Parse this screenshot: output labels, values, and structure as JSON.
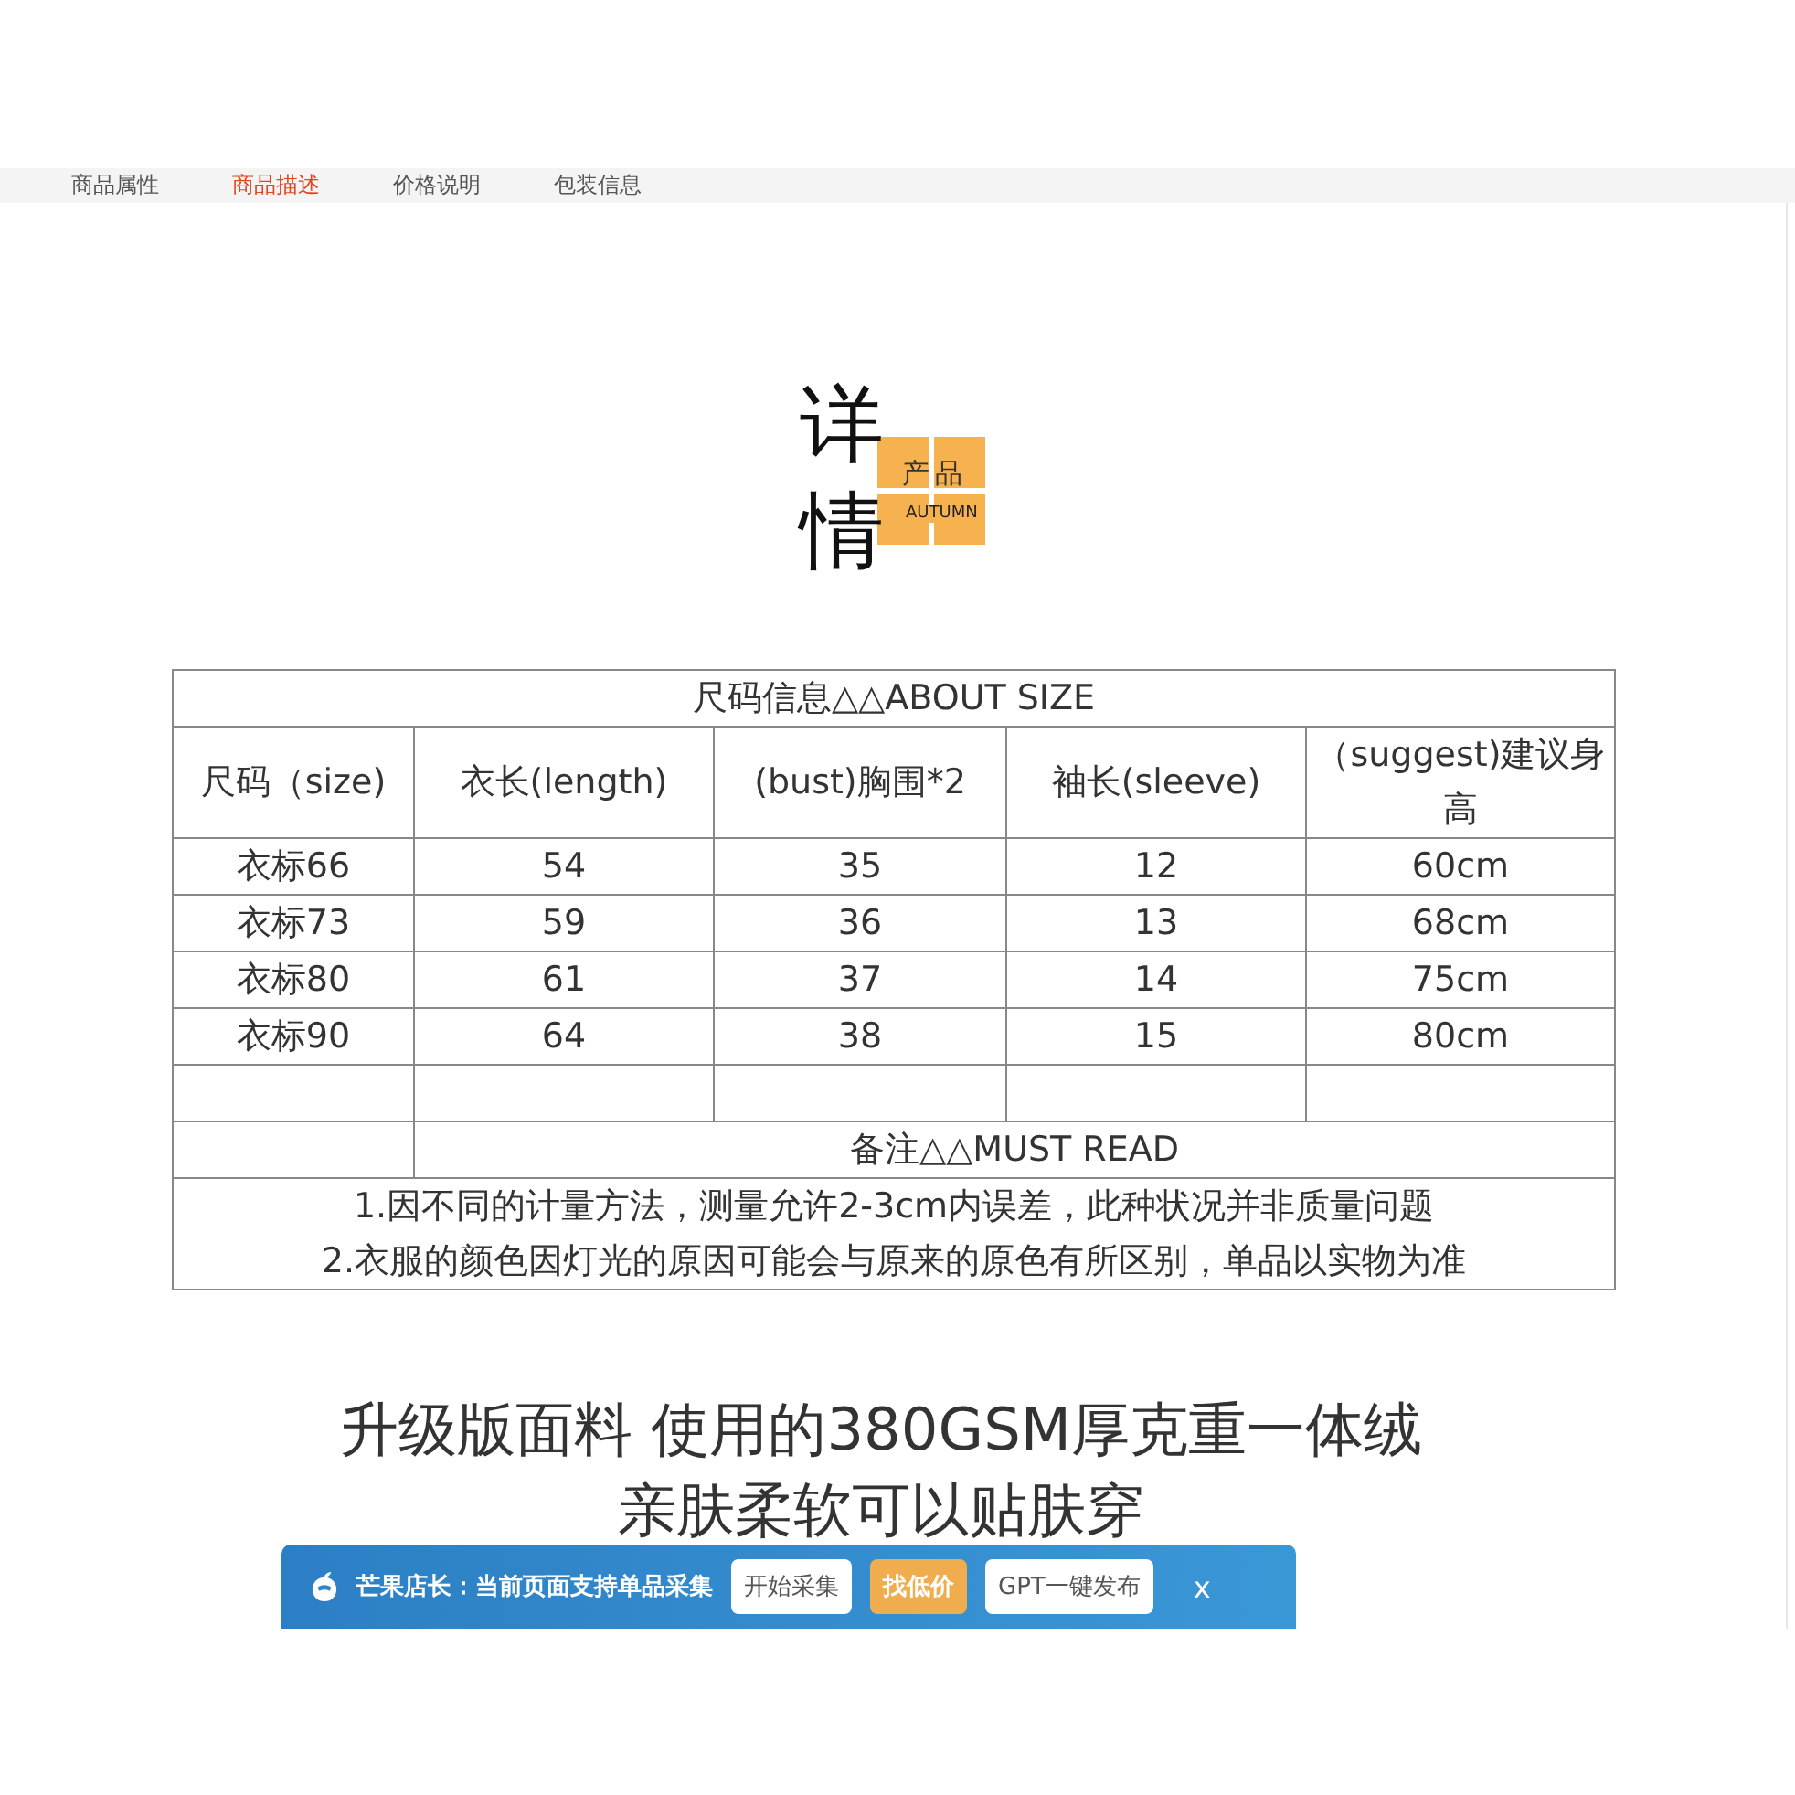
{
  "tabs": [
    {
      "label": "商品属性",
      "selected": false
    },
    {
      "label": "商品描述",
      "selected": true
    },
    {
      "label": "价格说明",
      "selected": false
    },
    {
      "label": "包装信息",
      "selected": false
    }
  ],
  "logo": {
    "title_chars": [
      "详",
      "情"
    ],
    "product": "产品",
    "subtitle": "AUTUMN"
  },
  "size_table": {
    "title": "尺码信息△△ABOUT SIZE",
    "columns": [
      "尺码（size)",
      "衣长(length)",
      "(bust)胸围*2",
      "袖长(sleeve)",
      "（suggest)建议身高"
    ],
    "rows": [
      [
        "衣标66",
        "54",
        "35",
        "12",
        "60cm"
      ],
      [
        "衣标73",
        "59",
        "36",
        "13",
        "68cm"
      ],
      [
        "衣标80",
        "61",
        "37",
        "14",
        "75cm"
      ],
      [
        "衣标90",
        "64",
        "38",
        "15",
        "80cm"
      ]
    ],
    "notes_title": "备注△△MUST READ",
    "notes": [
      "1.因不同的计量方法，测量允许2-3cm内误差，此种状况并非质量问题",
      "2.衣服的颜色因灯光的原因可能会与原来的原色有所区别，单品以实物为准"
    ]
  },
  "headline": [
    "升级版面料 使用的380GSM厚克重一体绒",
    "亲肤柔软可以贴肤穿"
  ],
  "toolbar": {
    "message": "芒果店长：当前页面支持单品采集",
    "buttons": [
      {
        "label": "开始采集",
        "kind": "plain"
      },
      {
        "label": "找低价",
        "kind": "accent"
      },
      {
        "label": "GPT一键发布",
        "kind": "plain"
      }
    ],
    "close": "x"
  }
}
